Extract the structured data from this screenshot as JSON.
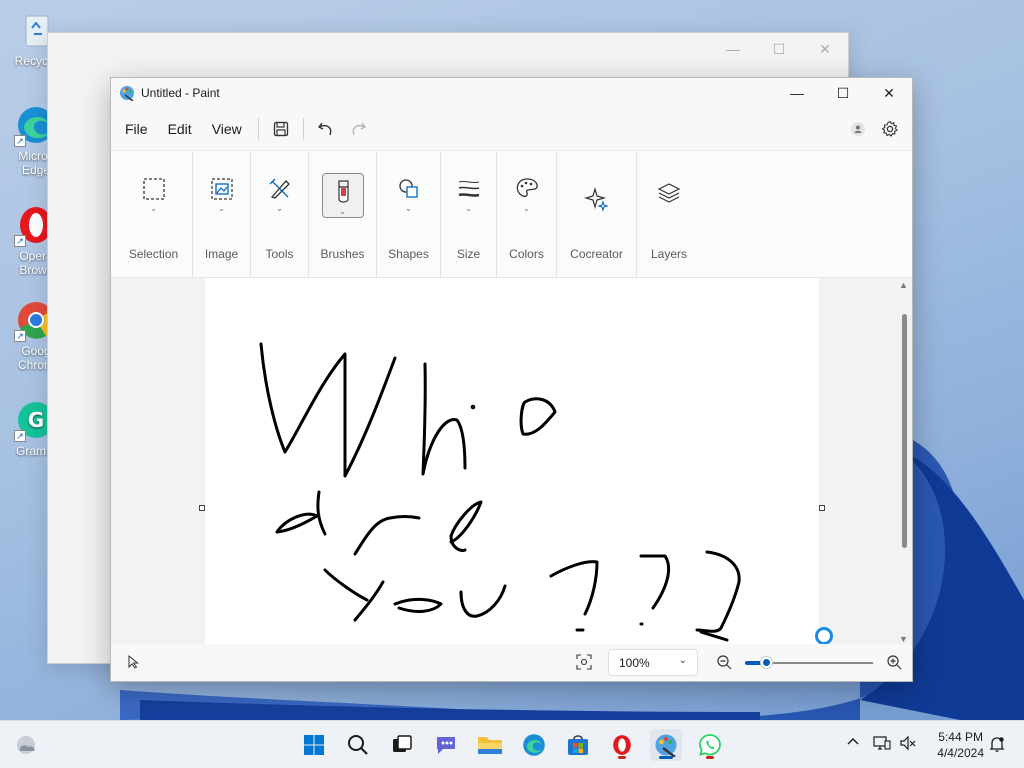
{
  "desktop": {
    "icons": [
      {
        "label": "Recycle",
        "icon": "recycle-bin-icon"
      },
      {
        "label": "Micros Edge",
        "icon": "edge-icon"
      },
      {
        "label": "Opera Brows",
        "icon": "opera-icon"
      },
      {
        "label": "Goog Chrom",
        "icon": "chrome-icon"
      },
      {
        "label": "Gramm",
        "icon": "grammarly-icon"
      }
    ]
  },
  "window": {
    "title": "Untitled - Paint",
    "menus": [
      "File",
      "Edit",
      "View"
    ]
  },
  "ribbon": {
    "groups": [
      {
        "label": "Selection",
        "icon": "selection-icon",
        "has_dropdown": true
      },
      {
        "label": "Image",
        "icon": "image-icon",
        "has_dropdown": true
      },
      {
        "label": "Tools",
        "icon": "tools-icon",
        "has_dropdown": true
      },
      {
        "label": "Brushes",
        "icon": "brush-icon",
        "has_dropdown": true,
        "active": true
      },
      {
        "label": "Shapes",
        "icon": "shapes-icon",
        "has_dropdown": true
      },
      {
        "label": "Size",
        "icon": "size-icon",
        "has_dropdown": true
      },
      {
        "label": "Colors",
        "icon": "palette-icon",
        "has_dropdown": true
      },
      {
        "label": "Cocreator",
        "icon": "cocreator-icon",
        "has_dropdown": false
      },
      {
        "label": "Layers",
        "icon": "layers-icon",
        "has_dropdown": false
      }
    ]
  },
  "canvas": {
    "drawing": "Who are You???"
  },
  "status": {
    "zoom": "100%",
    "zoom_fraction": 0.1
  },
  "taskbar": {
    "apps": [
      "windows-start-icon",
      "search-icon",
      "task-view-icon",
      "teams-chat-icon",
      "file-explorer-icon",
      "edge-icon",
      "store-icon",
      "opera-icon",
      "paint-icon",
      "whatsapp-icon"
    ],
    "time": "5:44 PM",
    "date": "4/4/2024"
  },
  "colors": {
    "accent": "#005fb8",
    "opera_red": "#c42b1c"
  }
}
